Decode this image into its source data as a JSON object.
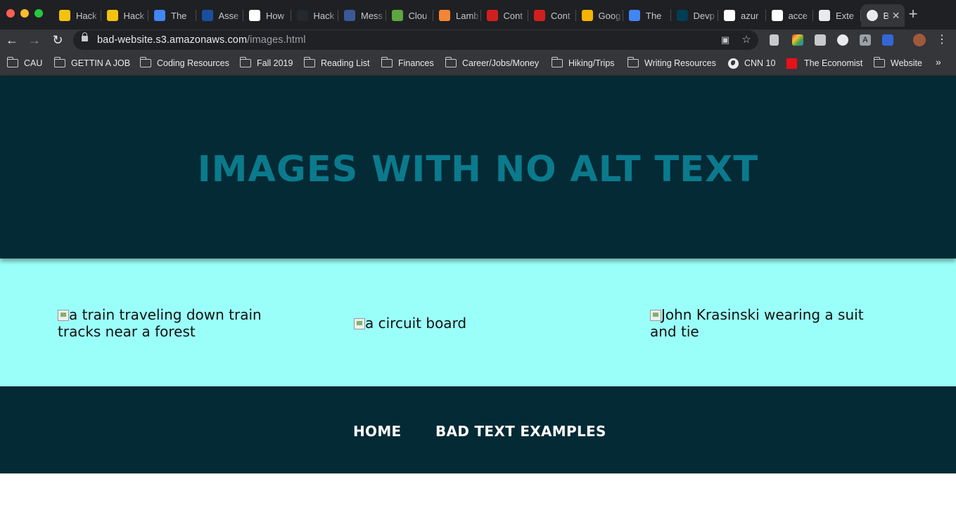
{
  "browser": {
    "tabs": [
      {
        "label": "Hack",
        "icon": "hackathon-icon",
        "color": "#f4c20d"
      },
      {
        "label": "Hack",
        "icon": "hackathon-icon",
        "color": "#f4c20d"
      },
      {
        "label": "The",
        "icon": "google-docs-icon",
        "color": "#4285f4"
      },
      {
        "label": "Asse",
        "icon": "heart-shield-icon",
        "color": "#1a4fa0"
      },
      {
        "label": "How",
        "icon": "w3schools-icon",
        "color": "#ffffff"
      },
      {
        "label": "Hack",
        "icon": "github-icon",
        "color": "#24292e"
      },
      {
        "label": "Mess",
        "icon": "facebook-icon",
        "color": "#3b5998"
      },
      {
        "label": "Clou",
        "icon": "cloud-icon",
        "color": "#5ea640"
      },
      {
        "label": "Lamb",
        "icon": "lambda-icon",
        "color": "#f58536"
      },
      {
        "label": "Cont",
        "icon": "bug-icon",
        "color": "#d11f1f"
      },
      {
        "label": "Cont",
        "icon": "bug-icon",
        "color": "#d11f1f"
      },
      {
        "label": "Goog",
        "icon": "google-slides-icon",
        "color": "#f4b400"
      },
      {
        "label": "The",
        "icon": "google-docs-icon",
        "color": "#4285f4"
      },
      {
        "label": "Devp",
        "icon": "devpost-icon",
        "color": "#003e54"
      },
      {
        "label": "azur",
        "icon": "google-icon",
        "color": "#ffffff"
      },
      {
        "label": "acce",
        "icon": "google-icon",
        "color": "#ffffff"
      },
      {
        "label": "Exte",
        "icon": "puzzle-icon",
        "color": "#e8eaed"
      }
    ],
    "active_tab": {
      "label": "B",
      "icon": "globe-icon"
    },
    "url_host": "bad-website.s3.amazonaws.com",
    "url_path": "/images.html",
    "bookmarks": [
      {
        "label": "CAU",
        "type": "folder"
      },
      {
        "label": "GETTIN A JOB",
        "type": "folder"
      },
      {
        "label": "Coding Resources",
        "type": "folder"
      },
      {
        "label": "Fall 2019",
        "type": "folder"
      },
      {
        "label": "Reading List",
        "type": "folder"
      },
      {
        "label": "Finances",
        "type": "folder"
      },
      {
        "label": "Career/Jobs/Money",
        "type": "folder"
      },
      {
        "label": "Hiking/Trips",
        "type": "folder"
      },
      {
        "label": "Writing Resources",
        "type": "folder"
      },
      {
        "label": "CNN 10",
        "type": "site"
      },
      {
        "label": "The Economist",
        "type": "site"
      },
      {
        "label": "Website",
        "type": "folder"
      }
    ]
  },
  "page": {
    "title": "IMAGES WITH NO ALT TEXT",
    "images": [
      {
        "text": "a train traveling down train tracks near a forest"
      },
      {
        "text": "a circuit board"
      },
      {
        "text": "John Krasinski wearing a suit and tie"
      }
    ],
    "nav": {
      "home": "HOME",
      "bad_text": "BAD TEXT EXAMPLES"
    }
  },
  "colors": {
    "header_bg": "#032a35",
    "title": "#0b7a8c",
    "gallery_bg": "#9bfff9",
    "footer_link": "#ffffff"
  }
}
